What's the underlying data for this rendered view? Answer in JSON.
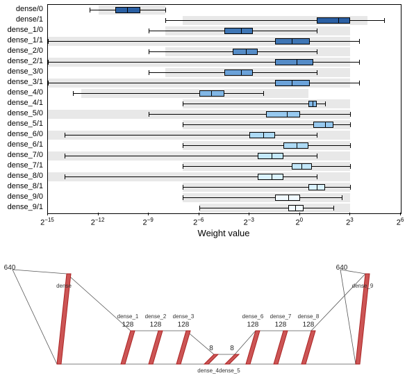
{
  "xlabel": "Weight value",
  "x_axis": {
    "domain_log2": [
      -15,
      6
    ],
    "ticks_exp": [
      -15,
      -12,
      -9,
      -6,
      -3,
      0,
      3,
      6
    ],
    "tick_labels": [
      "2⁻¹⁵",
      "2⁻¹²",
      "2⁻⁹",
      "2⁻⁶",
      "2⁻³",
      "2⁰",
      "2³",
      "2⁶"
    ]
  },
  "chart_data": {
    "type": "boxplot",
    "xscale": "log2",
    "categories": [
      "dense/0",
      "dense/1",
      "dense_1/0",
      "dense_1/1",
      "dense_2/0",
      "dense_2/1",
      "dense_3/0",
      "dense_3/1",
      "dense_4/0",
      "dense_4/1",
      "dense_5/0",
      "dense_5/1",
      "dense_6/0",
      "dense_6/1",
      "dense_7/0",
      "dense_7/1",
      "dense_8/0",
      "dense_8/1",
      "dense_9/0",
      "dense_9/1"
    ],
    "band_log2": [
      [
        -12,
        -8
      ],
      [
        -7,
        4
      ],
      [
        -8,
        3
      ],
      [
        -15,
        3
      ],
      [
        -8,
        3
      ],
      [
        -15,
        3
      ],
      [
        -8,
        3
      ],
      [
        -15,
        3
      ],
      [
        -13,
        0.5
      ],
      [
        -7,
        3
      ],
      [
        -15,
        3
      ],
      [
        -7,
        3
      ],
      [
        -15,
        3
      ],
      [
        -7,
        3
      ],
      [
        -15,
        3
      ],
      [
        -7,
        3
      ],
      [
        -15,
        3
      ],
      [
        -7,
        3
      ],
      [
        -7,
        3
      ],
      [
        -6,
        3
      ]
    ],
    "colors": [
      "#2a5fa3",
      "#2a5fa3",
      "#3f76b5",
      "#3f76b5",
      "#558cc7",
      "#558cc7",
      "#6ba2d9",
      "#6ba2d9",
      "#81b7e6",
      "#81b7e6",
      "#97c9ef",
      "#97c9ef",
      "#addaf5",
      "#addaf5",
      "#c3e8fb",
      "#c3e8fb",
      "#daf2fe",
      "#daf2fe",
      "#f1faff",
      "#f1faff"
    ],
    "whisker_lo_log2": [
      -12.5,
      -8,
      -9,
      -15,
      -9,
      -15,
      -9,
      -15,
      -13.5,
      -7,
      -9,
      -7,
      -14,
      -7,
      -14,
      -7,
      -14,
      -7,
      -7,
      -6
    ],
    "whisker_hi_log2": [
      -8,
      5,
      1,
      3.5,
      1,
      3.5,
      1,
      3.5,
      -2.2,
      1.5,
      3,
      3,
      1,
      3,
      1,
      3,
      1,
      3,
      2.5,
      2
    ],
    "q1_log2": [
      -11,
      1,
      -4.5,
      -1.5,
      -4,
      -1.5,
      -4.5,
      -1.5,
      -6,
      0.5,
      -2,
      0.8,
      -3,
      -1,
      -2.5,
      -0.5,
      -2.5,
      0.5,
      -1.5,
      -0.7
    ],
    "q3_log2": [
      -9.5,
      3,
      -2.8,
      0.6,
      -2.5,
      0.8,
      -2.8,
      0.6,
      -4.5,
      1,
      0,
      2,
      -1.5,
      0.5,
      -1,
      0.7,
      -1,
      1.5,
      0,
      0.2
    ],
    "median_log2": [
      -10.3,
      2.3,
      -3.5,
      -0.5,
      -3.2,
      -0.2,
      -3.5,
      -0.5,
      -5.3,
      0.75,
      -0.8,
      1.5,
      -2.2,
      -0.2,
      -1.7,
      0.1,
      -1.7,
      1,
      -0.7,
      -0.3
    ]
  },
  "diagram": {
    "io": {
      "in": "640",
      "out": "640"
    },
    "layers": [
      {
        "name": "dense",
        "units": "640"
      },
      {
        "name": "dense_1",
        "units": "128"
      },
      {
        "name": "dense_2",
        "units": "128"
      },
      {
        "name": "dense_3",
        "units": "128"
      },
      {
        "name": "dense_4",
        "units": "8"
      },
      {
        "name": "dense_5",
        "units": "8"
      },
      {
        "name": "dense_6",
        "units": "128"
      },
      {
        "name": "dense_7",
        "units": "128"
      },
      {
        "name": "dense_8",
        "units": "128"
      },
      {
        "name": "dense_9",
        "units": "640"
      }
    ],
    "bottom_labels": [
      "dense_4",
      "dense_5"
    ]
  }
}
